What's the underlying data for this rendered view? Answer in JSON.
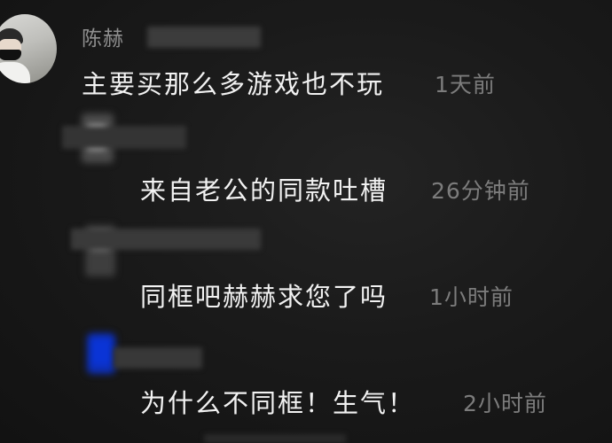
{
  "comments": [
    {
      "username": "陈赫",
      "text": "主要买那么多游戏也不玩",
      "time": "1天前"
    },
    {
      "username": "",
      "text": "来自老公的同款吐槽",
      "time": "26分钟前"
    },
    {
      "username": "",
      "text": "同框吧赫赫求您了吗",
      "time": "1小时前"
    },
    {
      "username": "",
      "text": "为什么不同框！生气！",
      "time": "2小时前"
    }
  ],
  "colors": {
    "background": "#161616",
    "comment_text": "#f2f2f2",
    "meta_text": "#7c7c7c",
    "username_text": "#8f8f8f"
  }
}
